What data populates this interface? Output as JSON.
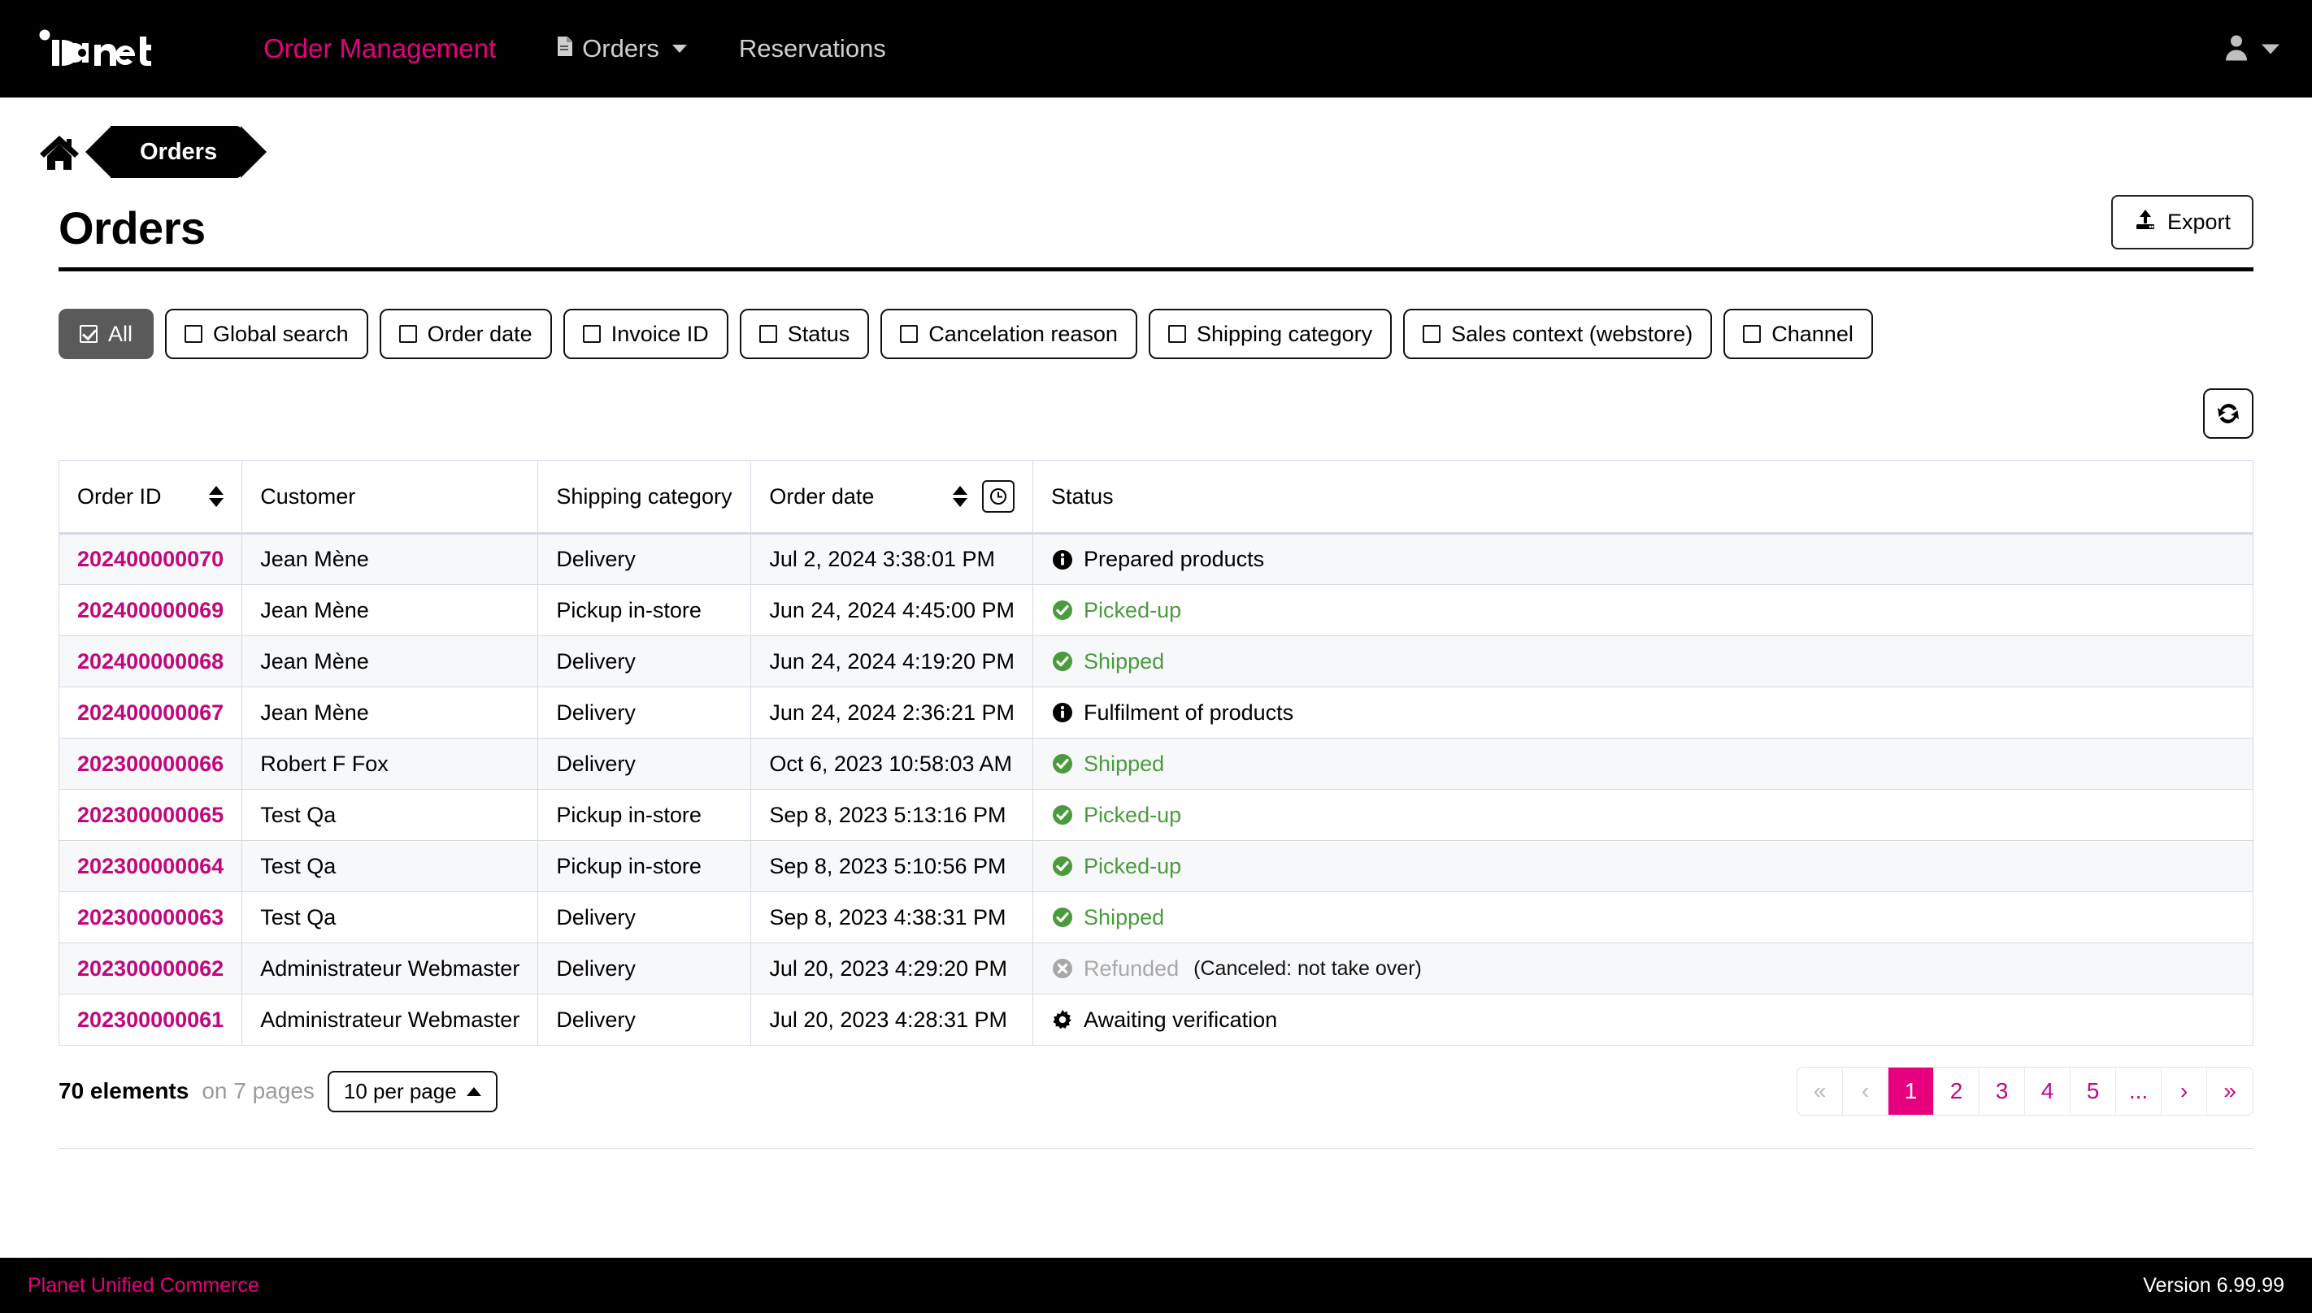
{
  "nav": {
    "logo_text": "planet",
    "brand_label": "Order Management",
    "orders_label": "Orders",
    "reservations_label": "Reservations"
  },
  "breadcrumb": {
    "home_label": "Home",
    "current": "Orders"
  },
  "page": {
    "title": "Orders",
    "export_label": "Export"
  },
  "filters": [
    {
      "label": "All",
      "checked": true
    },
    {
      "label": "Global search",
      "checked": false
    },
    {
      "label": "Order date",
      "checked": false
    },
    {
      "label": "Invoice ID",
      "checked": false
    },
    {
      "label": "Status",
      "checked": false
    },
    {
      "label": "Cancelation reason",
      "checked": false
    },
    {
      "label": "Shipping category",
      "checked": false
    },
    {
      "label": "Sales context (webstore)",
      "checked": false
    },
    {
      "label": "Channel",
      "checked": false
    }
  ],
  "table": {
    "columns": [
      "Order ID",
      "Customer",
      "Shipping category",
      "Order date",
      "Status"
    ],
    "rows": [
      {
        "order_id": "202400000070",
        "customer": "Jean Mène",
        "shipping": "Delivery",
        "date": "Jul 2, 2024 3:38:01 PM",
        "status": "Prepared products",
        "status_icon": "info-circle-icon",
        "status_style": "black",
        "status_suffix": ""
      },
      {
        "order_id": "202400000069",
        "customer": "Jean Mène",
        "shipping": "Pickup in-store",
        "date": "Jun 24, 2024 4:45:00 PM",
        "status": "Picked-up",
        "status_icon": "check-circle-icon",
        "status_style": "green",
        "status_suffix": ""
      },
      {
        "order_id": "202400000068",
        "customer": "Jean Mène",
        "shipping": "Delivery",
        "date": "Jun 24, 2024 4:19:20 PM",
        "status": "Shipped",
        "status_icon": "check-circle-icon",
        "status_style": "green",
        "status_suffix": ""
      },
      {
        "order_id": "202400000067",
        "customer": "Jean Mène",
        "shipping": "Delivery",
        "date": "Jun 24, 2024 2:36:21 PM",
        "status": "Fulfilment of products",
        "status_icon": "info-circle-icon",
        "status_style": "black",
        "status_suffix": ""
      },
      {
        "order_id": "202300000066",
        "customer": "Robert F Fox",
        "shipping": "Delivery",
        "date": "Oct 6, 2023 10:58:03 AM",
        "status": "Shipped",
        "status_icon": "check-circle-icon",
        "status_style": "green",
        "status_suffix": ""
      },
      {
        "order_id": "202300000065",
        "customer": "Test Qa",
        "shipping": "Pickup in-store",
        "date": "Sep 8, 2023 5:13:16 PM",
        "status": "Picked-up",
        "status_icon": "check-circle-icon",
        "status_style": "green",
        "status_suffix": ""
      },
      {
        "order_id": "202300000064",
        "customer": "Test Qa",
        "shipping": "Pickup in-store",
        "date": "Sep 8, 2023 5:10:56 PM",
        "status": "Picked-up",
        "status_icon": "check-circle-icon",
        "status_style": "green",
        "status_suffix": ""
      },
      {
        "order_id": "202300000063",
        "customer": "Test Qa",
        "shipping": "Delivery",
        "date": "Sep 8, 2023 4:38:31 PM",
        "status": "Shipped",
        "status_icon": "check-circle-icon",
        "status_style": "green",
        "status_suffix": ""
      },
      {
        "order_id": "202300000062",
        "customer": "Administrateur Webmaster",
        "shipping": "Delivery",
        "date": "Jul 20, 2023 4:29:20 PM",
        "status": "Refunded",
        "status_icon": "x-circle-icon",
        "status_style": "grey",
        "status_suffix": "(Canceled: not take over)"
      },
      {
        "order_id": "202300000061",
        "customer": "Administrateur Webmaster",
        "shipping": "Delivery",
        "date": "Jul 20, 2023 4:28:31 PM",
        "status": "Awaiting verification",
        "status_icon": "gear-icon",
        "status_style": "black",
        "status_suffix": ""
      }
    ]
  },
  "pagination": {
    "count_strong": "70 elements",
    "count_dim": "on 7 pages",
    "per_page_label": "10 per page",
    "first": "«",
    "prev": "‹",
    "pages": [
      "1",
      "2",
      "3",
      "4",
      "5",
      "..."
    ],
    "current_page": "1",
    "next": "›",
    "last": "»"
  },
  "footer": {
    "left": "Planet Unified Commerce",
    "right": "Version 6.99.99"
  },
  "colors": {
    "brand_magenta": "#e6007e",
    "link_magenta": "#c2077d",
    "status_green": "#4a9b3d",
    "status_grey": "#a8a8a8",
    "nav_black": "#000000"
  }
}
